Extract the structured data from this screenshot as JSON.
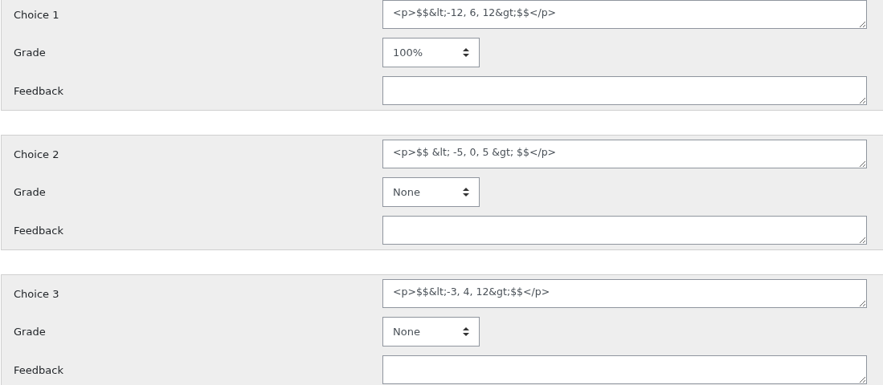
{
  "choices": [
    {
      "label": "Choice 1",
      "answer": "<p>$$&lt;-12, 6, 12&gt;$$</p>",
      "grade_label": "Grade",
      "grade": "100%",
      "feedback_label": "Feedback"
    },
    {
      "label": "Choice 2",
      "answer": "<p>$$ &lt; -5, 0, 5 &gt; $$</p>",
      "grade_label": "Grade",
      "grade": "None",
      "feedback_label": "Feedback"
    },
    {
      "label": "Choice 3",
      "answer": "<p>$$&lt;-3, 4, 12&gt;$$</p>",
      "grade_label": "Grade",
      "grade": "None",
      "feedback_label": "Feedback"
    }
  ]
}
